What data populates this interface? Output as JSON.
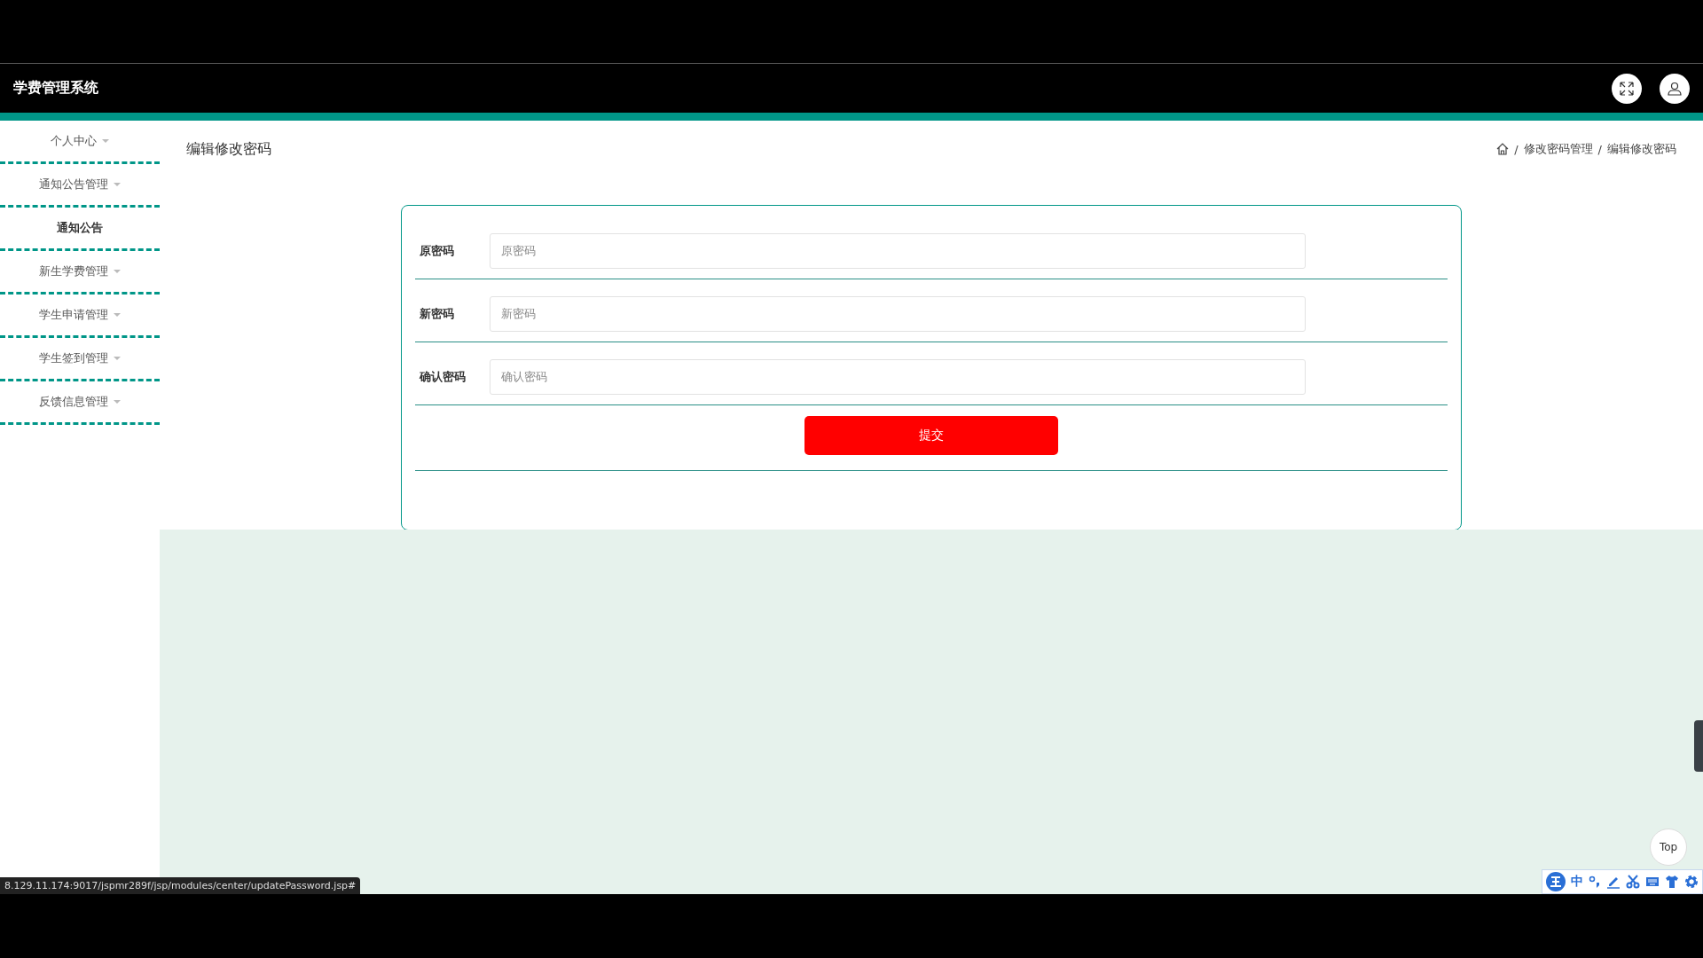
{
  "header": {
    "title": "学费管理系统"
  },
  "sidebar": {
    "items": [
      {
        "label": "个人中心"
      },
      {
        "label": "通知公告管理",
        "children": [
          {
            "label": "通知公告"
          }
        ]
      },
      {
        "label": "新生学费管理"
      },
      {
        "label": "学生申请管理"
      },
      {
        "label": "学生签到管理"
      },
      {
        "label": "反馈信息管理"
      }
    ]
  },
  "page": {
    "title": "编辑修改密码",
    "breadcrumb": [
      "修改密码管理",
      "编辑修改密码"
    ],
    "separator": "/"
  },
  "form": {
    "fields": [
      {
        "label": "原密码",
        "placeholder": "原密码"
      },
      {
        "label": "新密码",
        "placeholder": "新密码"
      },
      {
        "label": "确认密码",
        "placeholder": "确认密码"
      }
    ],
    "submit": "提交"
  },
  "top_button": "Top",
  "status_url": "8.129.11.174:9017/jspmr289f/jsp/modules/center/updatePassword.jsp#",
  "ime_bar": {
    "mode": "中"
  }
}
